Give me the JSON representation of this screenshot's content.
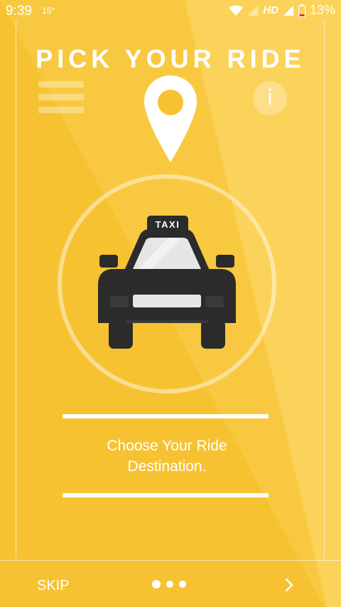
{
  "status_bar": {
    "time": "9:39",
    "temperature": "15°",
    "network": "HD",
    "battery": "13%"
  },
  "page": {
    "title": "PICK YOUR RIDE",
    "caption_line1": "Choose Your Ride",
    "caption_line2": "Destination."
  },
  "taxi_sign": "TAXI",
  "icons": {
    "info": "i",
    "menu": "menu-icon",
    "pin": "location-pin-icon",
    "taxi": "taxi-icon"
  },
  "footer": {
    "skip_label": "SKIP",
    "pager": {
      "count": 3,
      "active_index": 0
    }
  },
  "colors": {
    "background": "#F7C232",
    "accent": "#FFFFFF",
    "car_body": "#2B2B2B"
  }
}
